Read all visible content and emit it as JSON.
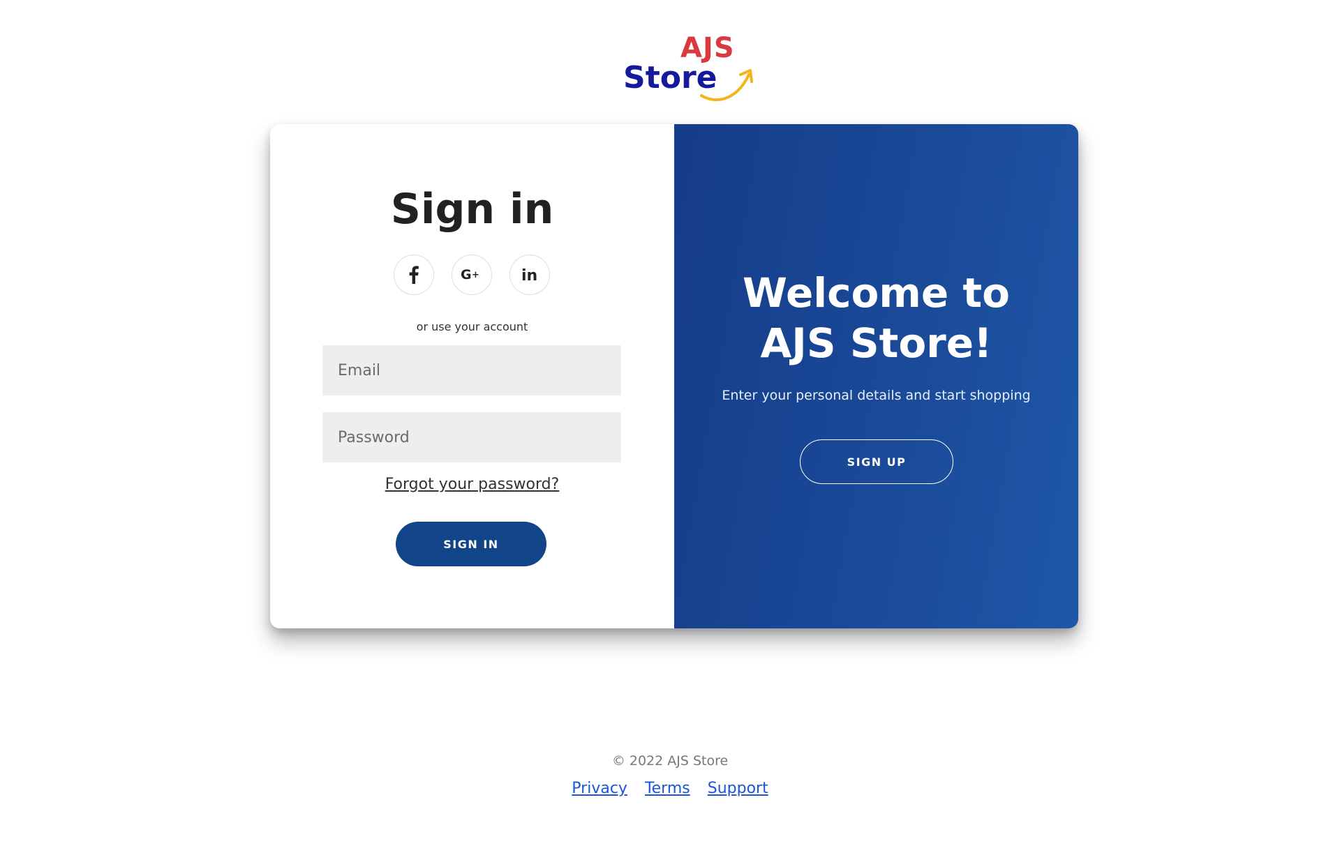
{
  "brand": {
    "logo_top": "AJS",
    "logo_bottom": "Store",
    "logo_colors": {
      "top": "#d93a3f",
      "bottom": "#141a9a",
      "arrow": "#f2b51d"
    }
  },
  "signin": {
    "title": "Sign in",
    "socials": [
      {
        "name": "facebook-icon",
        "glyph": "f"
      },
      {
        "name": "google-plus-icon",
        "glyph": "G+"
      },
      {
        "name": "linkedin-icon",
        "glyph": "in"
      }
    ],
    "or_text": "or use your account",
    "email_placeholder": "Email",
    "password_placeholder": "Password",
    "forgot_label": "Forgot your password?",
    "submit_label": "SIGN IN",
    "accent_color": "#114488"
  },
  "welcome": {
    "line1": "Welcome to",
    "line2": "AJS Store!",
    "tagline": "Enter your personal details and start shopping",
    "signup_label": "SIGN UP"
  },
  "footer": {
    "copyright": "© 2022 AJS Store",
    "links": [
      "Privacy",
      "Terms",
      "Support"
    ],
    "link_color": "#1a56d6"
  }
}
